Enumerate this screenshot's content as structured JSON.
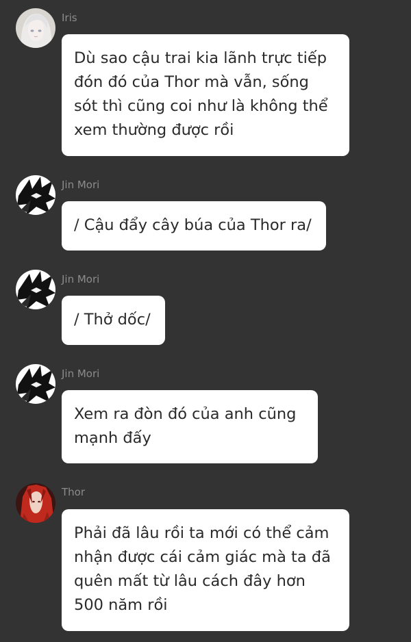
{
  "messages": [
    {
      "sender": "Iris",
      "avatar_icon": "iris-avatar",
      "lines": [
        "Dù sao cậu trai kia lãnh trực tiếp",
        "đón đó của Thor mà vẫn, sống",
        "sót thì cũng coi như là không thể",
        "xem thường được rồi"
      ]
    },
    {
      "sender": "Jin Mori",
      "avatar_icon": "jin-mori-avatar",
      "lines": [
        "/ Cậu đẩy cây búa của Thor ra/"
      ]
    },
    {
      "sender": "Jin Mori",
      "avatar_icon": "jin-mori-avatar",
      "lines": [
        "/ Thở dốc/"
      ]
    },
    {
      "sender": "Jin Mori",
      "avatar_icon": "jin-mori-avatar",
      "lines": [
        "Xem ra đòn đó của anh cũng",
        "mạnh đấy"
      ]
    },
    {
      "sender": "Thor",
      "avatar_icon": "thor-avatar",
      "lines": [
        "Phải đã lâu rồi ta mới có thể cảm",
        "nhận được cái cảm giác mà ta đã",
        "quên mất từ lâu cách đây hơn",
        "500 năm rồi"
      ]
    }
  ],
  "colors": {
    "background": "#333333",
    "bubble": "#ffffff",
    "text": "#2a2a2a",
    "sender": "#8c8c8c"
  }
}
